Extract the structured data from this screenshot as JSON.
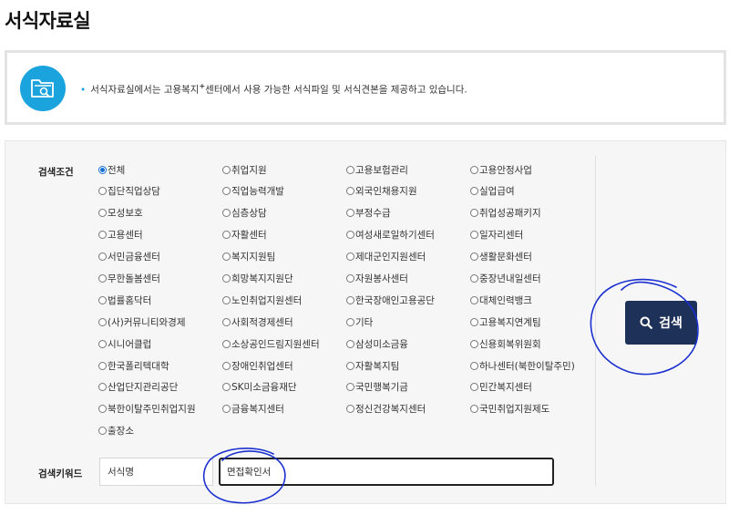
{
  "page": {
    "title": "서식자료실"
  },
  "info": {
    "icon": "folder-search-icon",
    "text_before": "서식자료실에서는 고용복지",
    "text_sup": "+",
    "text_after": "센터에서 사용 가능한 서식파일 및 서식견본을 제공하고 있습니다."
  },
  "search": {
    "condition_label": "검색조건",
    "keyword_label": "검색키워드",
    "selected_option": "전체",
    "options": [
      "전체",
      "취업지원",
      "고용보험관리",
      "고용안정사업",
      "집단직업상담",
      "직업능력개발",
      "외국인채용지원",
      "실업급여",
      "모성보호",
      "심층상담",
      "부정수급",
      "취업성공패키지",
      "고용센터",
      "자활센터",
      "여성새로일하기센터",
      "일자리센터",
      "서민금융센터",
      "복지지원팀",
      "제대군인지원센터",
      "생활문화센터",
      "무한돌봄센터",
      "희망복지지원단",
      "자원봉사센터",
      "중장년내일센터",
      "법률홈닥터",
      "노인취업지원센터",
      "한국장애인고용공단",
      "대체인력뱅크",
      "(사)커뮤니티와경제",
      "사회적경제센터",
      "기타",
      "고용복지연계팀",
      "시니어클럽",
      "소상공인드림지원센터",
      "삼성미소금융",
      "신용회복위원회",
      "한국폴리텍대학",
      "장애인취업센터",
      "자활복지팀",
      "하나센터(북한이탈주민)",
      "산업단지관리공단",
      "SK미소금융재단",
      "국민행복기금",
      "민간복지센터",
      "북한이탈주민취업지원",
      "금융복지센터",
      "정신건강복지센터",
      "국민취업지원제도",
      "출장소"
    ],
    "keyword_type": "서식명",
    "keyword_value": "면접확인서",
    "button_label": "검색",
    "button_icon": "search-icon",
    "button_color": "#1e3158",
    "accent_color": "#1aa3dc"
  },
  "annotations": {
    "ink_color": "#1a2fd0"
  }
}
